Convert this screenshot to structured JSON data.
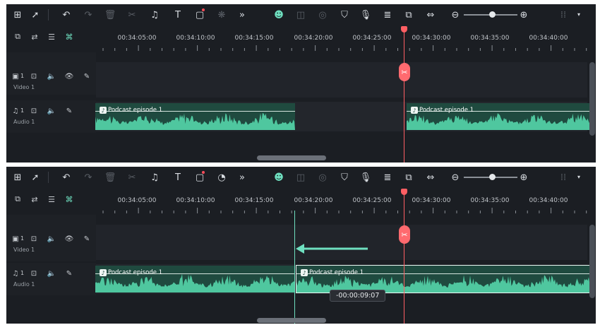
{
  "panels": [
    {
      "id": "before",
      "ruler": [
        "00:34:05:00",
        "00:34:10:00",
        "00:34:15:00",
        "00:34:20:00",
        "00:34:25:00",
        "00:34:30:00",
        "00:34:35:00",
        "00:34:40:00"
      ],
      "tracks": {
        "video": {
          "name": "Video 1",
          "index": "1"
        },
        "audio": {
          "name": "Audio 1",
          "index": "1"
        }
      },
      "clips": [
        {
          "name": "Podcast episode 1"
        },
        {
          "name": "Podcast episode 1"
        }
      ]
    },
    {
      "id": "after",
      "ruler": [
        "00:34:05:00",
        "00:34:10:00",
        "00:34:15:00",
        "00:34:20:00",
        "00:34:25:00",
        "00:34:30:00",
        "00:34:35:00",
        "00:34:40:00"
      ],
      "tracks": {
        "video": {
          "name": "Video 1",
          "index": "1"
        },
        "audio": {
          "name": "Audio 1",
          "index": "1"
        }
      },
      "clips": [
        {
          "name": "Podcast episode 1"
        },
        {
          "name": "Podcast episode 1"
        }
      ],
      "tooltip": "-00:00:09:07"
    }
  ],
  "colors": {
    "accent": "#6fe0c0",
    "playhead": "#ff5f63",
    "clip_fill": "#1f4a3f",
    "waveform": "#4fc79f",
    "panel_bg": "#1b1e23"
  },
  "toolbar_icons": [
    "layout-icon",
    "select-arrow-icon",
    "undo-icon",
    "redo-icon",
    "delete-icon",
    "split-icon",
    "audio-icon",
    "text-icon",
    "crop-icon",
    "color-icon",
    "more-icon",
    "ai-face-icon",
    "mask-icon",
    "render-icon",
    "shield-icon",
    "mic-icon",
    "audio-list-icon",
    "pip-icon",
    "fit-icon",
    "zoom-out-icon",
    "zoom-slider",
    "zoom-in-icon",
    "grid-icon",
    "dropdown-icon"
  ]
}
